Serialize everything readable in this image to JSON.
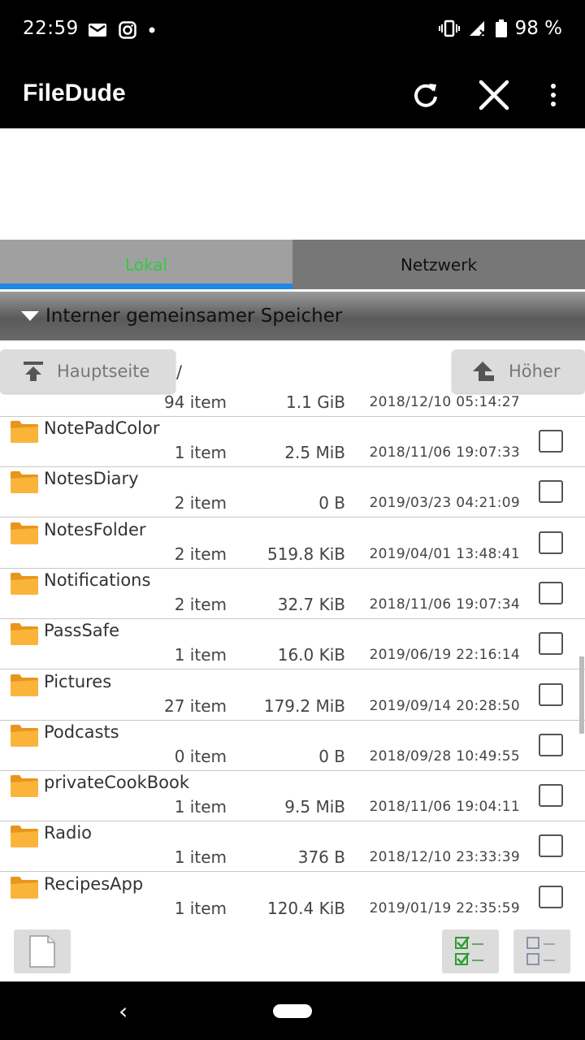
{
  "status": {
    "time": "22:59",
    "battery": "98 %",
    "icons_left": [
      "gmail-icon",
      "instagram-icon",
      "dot-icon"
    ],
    "icons_right": [
      "vibrate-icon",
      "signal-icon",
      "battery-icon"
    ]
  },
  "appbar": {
    "title": "FileDude",
    "actions": [
      "refresh-icon",
      "close-icon",
      "more-vert-icon"
    ]
  },
  "tabs": [
    {
      "label": "Lokal",
      "active": true
    },
    {
      "label": "Netzwerk",
      "active": false
    }
  ],
  "storage": {
    "label": "Interner gemeinsamer Speicher"
  },
  "nav": {
    "home_label": "Hauptseite",
    "path": "/",
    "up_label": "Höher"
  },
  "partial_row": {
    "count": "94 item",
    "size": "1.1 GiB",
    "date": "2018/12/10 05:14:27"
  },
  "files": [
    {
      "name": "NotePadColor",
      "count": "1 item",
      "size": "2.5 MiB",
      "date": "2018/11/06 19:07:33"
    },
    {
      "name": "NotesDiary",
      "count": "2 item",
      "size": "0 B",
      "date": "2019/03/23 04:21:09"
    },
    {
      "name": "NotesFolder",
      "count": "2 item",
      "size": "519.8 KiB",
      "date": "2019/04/01 13:48:41"
    },
    {
      "name": "Notifications",
      "count": "2 item",
      "size": "32.7 KiB",
      "date": "2018/11/06 19:07:34"
    },
    {
      "name": "PassSafe",
      "count": "1 item",
      "size": "16.0 KiB",
      "date": "2019/06/19 22:16:14"
    },
    {
      "name": "Pictures",
      "count": "27 item",
      "size": "179.2 MiB",
      "date": "2019/09/14 20:28:50"
    },
    {
      "name": "Podcasts",
      "count": "0 item",
      "size": "0 B",
      "date": "2018/09/28 10:49:55"
    },
    {
      "name": "privateCookBook",
      "count": "1 item",
      "size": "9.5 MiB",
      "date": "2018/11/06 19:04:11"
    },
    {
      "name": "Radio",
      "count": "1 item",
      "size": "376 B",
      "date": "2018/12/10 23:33:39"
    },
    {
      "name": "RecipesApp",
      "count": "1 item",
      "size": "120.4 KiB",
      "date": "2019/01/19 22:35:59"
    }
  ],
  "colors": {
    "active_tab_text": "#2ecc40",
    "tab_indicator": "#1e88e5",
    "folder": "#f5a623"
  },
  "bottom_actions": [
    "new-file-icon",
    "select-all-icon",
    "deselect-all-icon"
  ]
}
